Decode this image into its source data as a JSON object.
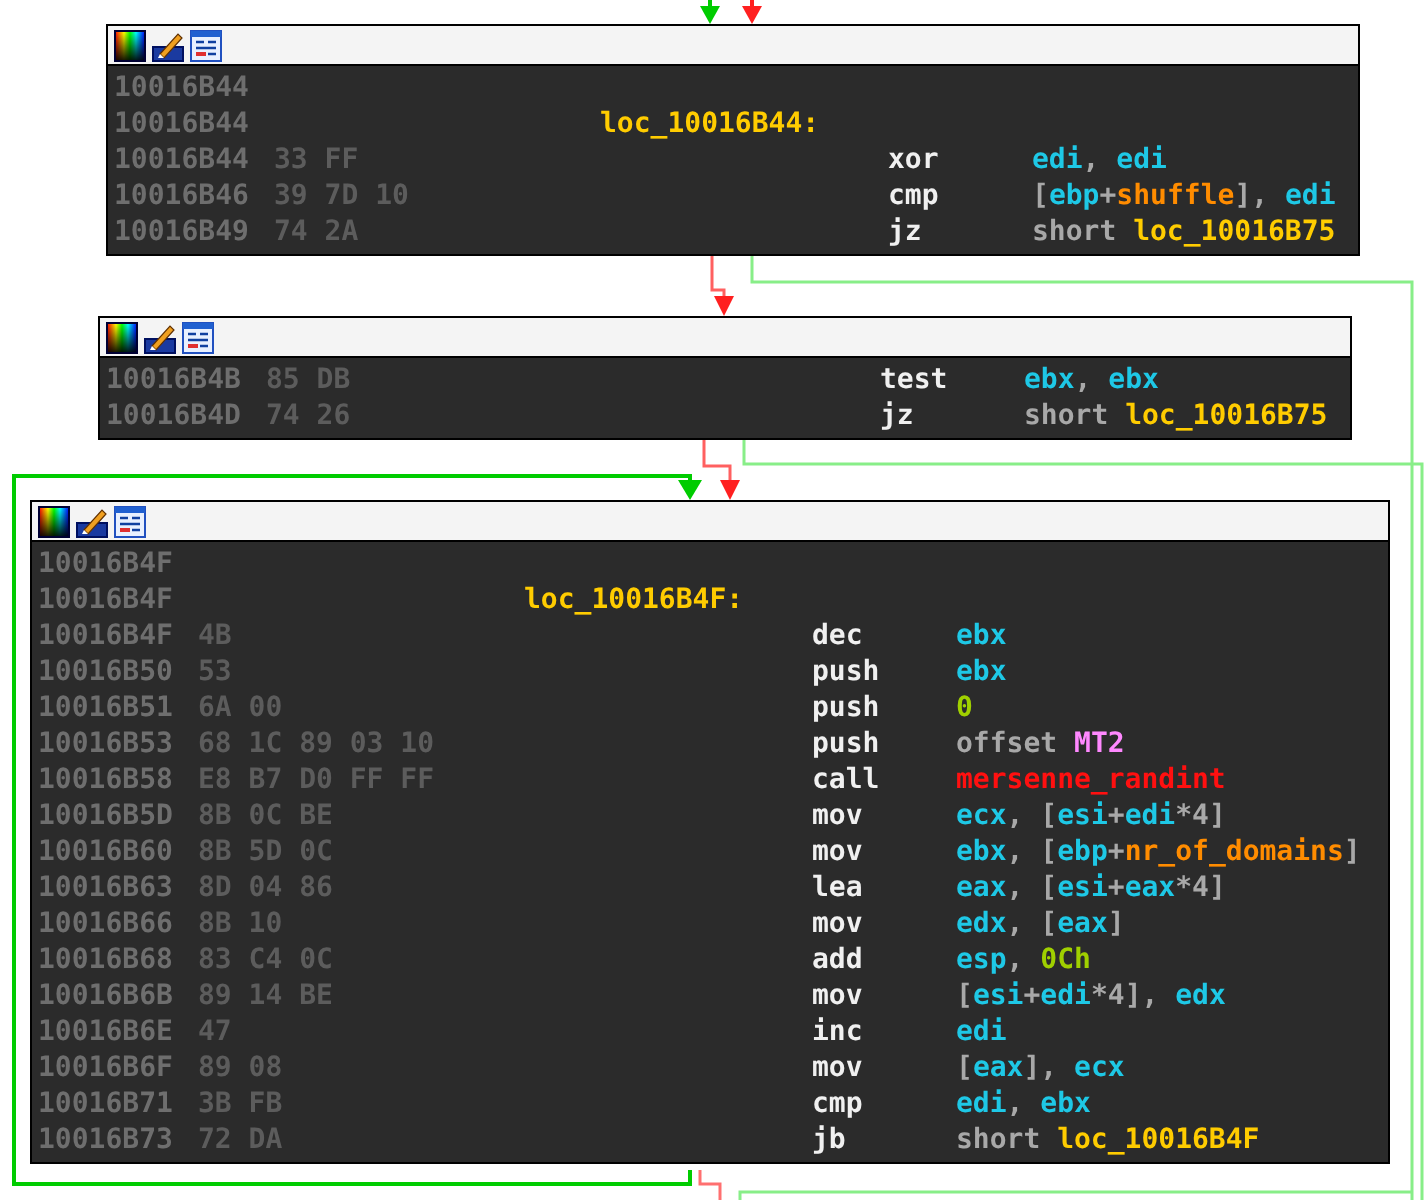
{
  "blocks": [
    {
      "lines": [
        {
          "address": "10016B44"
        },
        {
          "address": "10016B44",
          "label": "loc_10016B44:"
        },
        {
          "address": "10016B44",
          "bytes": "33 FF",
          "mnemonic": "xor",
          "operand": [
            {
              "kind": "reg",
              "text": "edi"
            },
            {
              "kind": "punct",
              "text": ", "
            },
            {
              "kind": "reg",
              "text": "edi"
            }
          ]
        },
        {
          "address": "10016B46",
          "bytes": "39 7D 10",
          "mnemonic": "cmp",
          "operand": [
            {
              "kind": "punct",
              "text": "["
            },
            {
              "kind": "reg",
              "text": "ebp"
            },
            {
              "kind": "punct",
              "text": "+"
            },
            {
              "kind": "var",
              "text": "shuffle"
            },
            {
              "kind": "punct",
              "text": "], "
            },
            {
              "kind": "reg",
              "text": "edi"
            }
          ]
        },
        {
          "address": "10016B49",
          "bytes": "74 2A",
          "mnemonic": "jz",
          "operand": [
            {
              "kind": "keyword",
              "text": "short "
            },
            {
              "kind": "label",
              "text": "loc_10016B75"
            }
          ]
        }
      ]
    },
    {
      "lines": [
        {
          "address": "10016B4B",
          "bytes": "85 DB",
          "mnemonic": "test",
          "operand": [
            {
              "kind": "reg",
              "text": "ebx"
            },
            {
              "kind": "punct",
              "text": ", "
            },
            {
              "kind": "reg",
              "text": "ebx"
            }
          ]
        },
        {
          "address": "10016B4D",
          "bytes": "74 26",
          "mnemonic": "jz",
          "operand": [
            {
              "kind": "keyword",
              "text": "short "
            },
            {
              "kind": "label",
              "text": "loc_10016B75"
            }
          ]
        }
      ]
    },
    {
      "lines": [
        {
          "address": "10016B4F"
        },
        {
          "address": "10016B4F",
          "label": "loc_10016B4F:"
        },
        {
          "address": "10016B4F",
          "bytes": "4B",
          "mnemonic": "dec",
          "operand": [
            {
              "kind": "reg",
              "text": "ebx"
            }
          ]
        },
        {
          "address": "10016B50",
          "bytes": "53",
          "mnemonic": "push",
          "operand": [
            {
              "kind": "reg",
              "text": "ebx"
            }
          ]
        },
        {
          "address": "10016B51",
          "bytes": "6A 00",
          "mnemonic": "push",
          "operand": [
            {
              "kind": "num",
              "text": "0"
            }
          ]
        },
        {
          "address": "10016B53",
          "bytes": "68 1C 89 03 10",
          "mnemonic": "push",
          "operand": [
            {
              "kind": "keyword",
              "text": "offset "
            },
            {
              "kind": "data",
              "text": "MT2"
            }
          ]
        },
        {
          "address": "10016B58",
          "bytes": "E8 B7 D0 FF FF",
          "mnemonic": "call",
          "operand": [
            {
              "kind": "func",
              "text": "mersenne_randint"
            }
          ]
        },
        {
          "address": "10016B5D",
          "bytes": "8B 0C BE",
          "mnemonic": "mov",
          "operand": [
            {
              "kind": "reg",
              "text": "ecx"
            },
            {
              "kind": "punct",
              "text": ", ["
            },
            {
              "kind": "reg",
              "text": "esi"
            },
            {
              "kind": "punct",
              "text": "+"
            },
            {
              "kind": "reg",
              "text": "edi"
            },
            {
              "kind": "punct",
              "text": "*4]"
            }
          ]
        },
        {
          "address": "10016B60",
          "bytes": "8B 5D 0C",
          "mnemonic": "mov",
          "operand": [
            {
              "kind": "reg",
              "text": "ebx"
            },
            {
              "kind": "punct",
              "text": ", ["
            },
            {
              "kind": "reg",
              "text": "ebp"
            },
            {
              "kind": "punct",
              "text": "+"
            },
            {
              "kind": "var",
              "text": "nr_of_domains"
            },
            {
              "kind": "punct",
              "text": "]"
            }
          ]
        },
        {
          "address": "10016B63",
          "bytes": "8D 04 86",
          "mnemonic": "lea",
          "operand": [
            {
              "kind": "reg",
              "text": "eax"
            },
            {
              "kind": "punct",
              "text": ", ["
            },
            {
              "kind": "reg",
              "text": "esi"
            },
            {
              "kind": "punct",
              "text": "+"
            },
            {
              "kind": "reg",
              "text": "eax"
            },
            {
              "kind": "punct",
              "text": "*4]"
            }
          ]
        },
        {
          "address": "10016B66",
          "bytes": "8B 10",
          "mnemonic": "mov",
          "operand": [
            {
              "kind": "reg",
              "text": "edx"
            },
            {
              "kind": "punct",
              "text": ", ["
            },
            {
              "kind": "reg",
              "text": "eax"
            },
            {
              "kind": "punct",
              "text": "]"
            }
          ]
        },
        {
          "address": "10016B68",
          "bytes": "83 C4 0C",
          "mnemonic": "add",
          "operand": [
            {
              "kind": "reg",
              "text": "esp"
            },
            {
              "kind": "punct",
              "text": ", "
            },
            {
              "kind": "num",
              "text": "0Ch"
            }
          ]
        },
        {
          "address": "10016B6B",
          "bytes": "89 14 BE",
          "mnemonic": "mov",
          "operand": [
            {
              "kind": "punct",
              "text": "["
            },
            {
              "kind": "reg",
              "text": "esi"
            },
            {
              "kind": "punct",
              "text": "+"
            },
            {
              "kind": "reg",
              "text": "edi"
            },
            {
              "kind": "punct",
              "text": "*4], "
            },
            {
              "kind": "reg",
              "text": "edx"
            }
          ]
        },
        {
          "address": "10016B6E",
          "bytes": "47",
          "mnemonic": "inc",
          "operand": [
            {
              "kind": "reg",
              "text": "edi"
            }
          ]
        },
        {
          "address": "10016B6F",
          "bytes": "89 08",
          "mnemonic": "mov",
          "operand": [
            {
              "kind": "punct",
              "text": "["
            },
            {
              "kind": "reg",
              "text": "eax"
            },
            {
              "kind": "punct",
              "text": "], "
            },
            {
              "kind": "reg",
              "text": "ecx"
            }
          ]
        },
        {
          "address": "10016B71",
          "bytes": "3B FB",
          "mnemonic": "cmp",
          "operand": [
            {
              "kind": "reg",
              "text": "edi"
            },
            {
              "kind": "punct",
              "text": ", "
            },
            {
              "kind": "reg",
              "text": "ebx"
            }
          ]
        },
        {
          "address": "10016B73",
          "bytes": "72 DA",
          "mnemonic": "jb",
          "operand": [
            {
              "kind": "keyword",
              "text": "short "
            },
            {
              "kind": "label",
              "text": "loc_10016B4F"
            }
          ]
        }
      ]
    }
  ]
}
